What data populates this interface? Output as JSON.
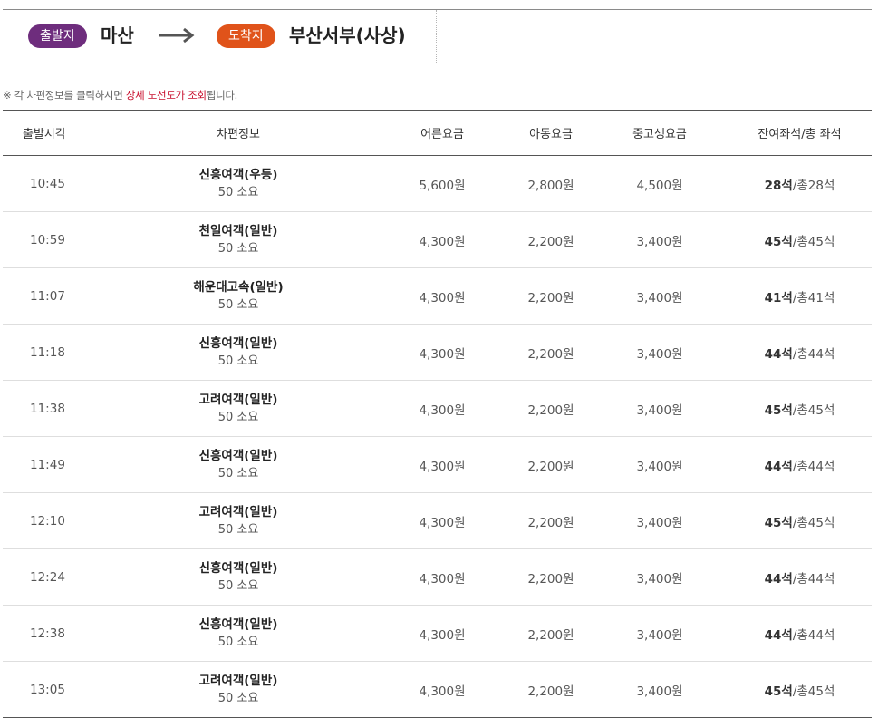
{
  "route": {
    "departure_badge": "출발지",
    "departure": "마산",
    "arrival_badge": "도착지",
    "arrival": "부산서부(사상)",
    "colors": {
      "departure_badge": "#6e2d7d",
      "arrival_badge": "#e0531a",
      "arrow": "#555555"
    }
  },
  "notice": {
    "prefix": "※ 각 차편정보를 클릭하시면 ",
    "highlight": "상세 노선도가 조회",
    "suffix": "됩니다.",
    "highlight_color": "#c8102e"
  },
  "table": {
    "headers": [
      "출발시각",
      "차편정보",
      "어른요금",
      "아동요금",
      "중고생요금",
      "잔여좌석/총 좌석"
    ],
    "rows": [
      {
        "time": "10:45",
        "company": "신흥여객(우등)",
        "duration": "50 소요",
        "adult": "5,600원",
        "child": "2,800원",
        "student": "4,500원",
        "seats_remaining": "28석",
        "seats_total": "/총28석"
      },
      {
        "time": "10:59",
        "company": "천일여객(일반)",
        "duration": "50 소요",
        "adult": "4,300원",
        "child": "2,200원",
        "student": "3,400원",
        "seats_remaining": "45석",
        "seats_total": "/총45석"
      },
      {
        "time": "11:07",
        "company": "해운대고속(일반)",
        "duration": "50 소요",
        "adult": "4,300원",
        "child": "2,200원",
        "student": "3,400원",
        "seats_remaining": "41석",
        "seats_total": "/총41석"
      },
      {
        "time": "11:18",
        "company": "신흥여객(일반)",
        "duration": "50 소요",
        "adult": "4,300원",
        "child": "2,200원",
        "student": "3,400원",
        "seats_remaining": "44석",
        "seats_total": "/총44석"
      },
      {
        "time": "11:38",
        "company": "고려여객(일반)",
        "duration": "50 소요",
        "adult": "4,300원",
        "child": "2,200원",
        "student": "3,400원",
        "seats_remaining": "45석",
        "seats_total": "/총45석"
      },
      {
        "time": "11:49",
        "company": "신흥여객(일반)",
        "duration": "50 소요",
        "adult": "4,300원",
        "child": "2,200원",
        "student": "3,400원",
        "seats_remaining": "44석",
        "seats_total": "/총44석"
      },
      {
        "time": "12:10",
        "company": "고려여객(일반)",
        "duration": "50 소요",
        "adult": "4,300원",
        "child": "2,200원",
        "student": "3,400원",
        "seats_remaining": "45석",
        "seats_total": "/총45석"
      },
      {
        "time": "12:24",
        "company": "신흥여객(일반)",
        "duration": "50 소요",
        "adult": "4,300원",
        "child": "2,200원",
        "student": "3,400원",
        "seats_remaining": "44석",
        "seats_total": "/총44석"
      },
      {
        "time": "12:38",
        "company": "신흥여객(일반)",
        "duration": "50 소요",
        "adult": "4,300원",
        "child": "2,200원",
        "student": "3,400원",
        "seats_remaining": "44석",
        "seats_total": "/총44석"
      },
      {
        "time": "13:05",
        "company": "고려여객(일반)",
        "duration": "50 소요",
        "adult": "4,300원",
        "child": "2,200원",
        "student": "3,400원",
        "seats_remaining": "45석",
        "seats_total": "/총45석"
      }
    ]
  }
}
